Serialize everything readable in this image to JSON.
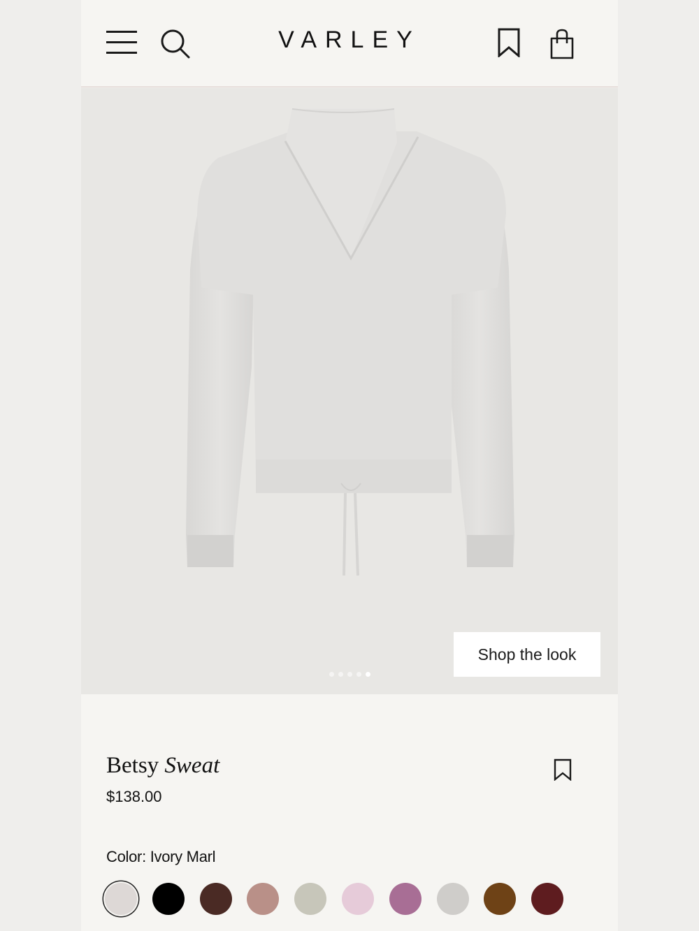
{
  "header": {
    "brand": "VARLEY",
    "icons": [
      "menu-icon",
      "search-icon",
      "bookmark-icon",
      "shopping-bag-icon"
    ]
  },
  "gallery": {
    "shop_the_look_label": "Shop the look",
    "slide_count": 5,
    "active_slide": 5
  },
  "product": {
    "name_regular": "Betsy",
    "name_italic": "Sweat",
    "price": "$138.00",
    "color_label": "Color: Ivory Marl",
    "swatches": [
      {
        "color": "#ddd8d6",
        "selected": true
      },
      {
        "color": "#000000",
        "selected": false
      },
      {
        "color": "#4a2a24",
        "selected": false
      },
      {
        "color": "#b99088",
        "selected": false
      },
      {
        "color": "#c7c6ba",
        "selected": false
      },
      {
        "color": "#e6cbd9",
        "selected": false
      },
      {
        "color": "#a86e95",
        "selected": false
      },
      {
        "color": "#cfcdca",
        "selected": false
      },
      {
        "color": "#6e4216",
        "selected": false
      },
      {
        "color": "#5e1c1f",
        "selected": false
      }
    ]
  }
}
